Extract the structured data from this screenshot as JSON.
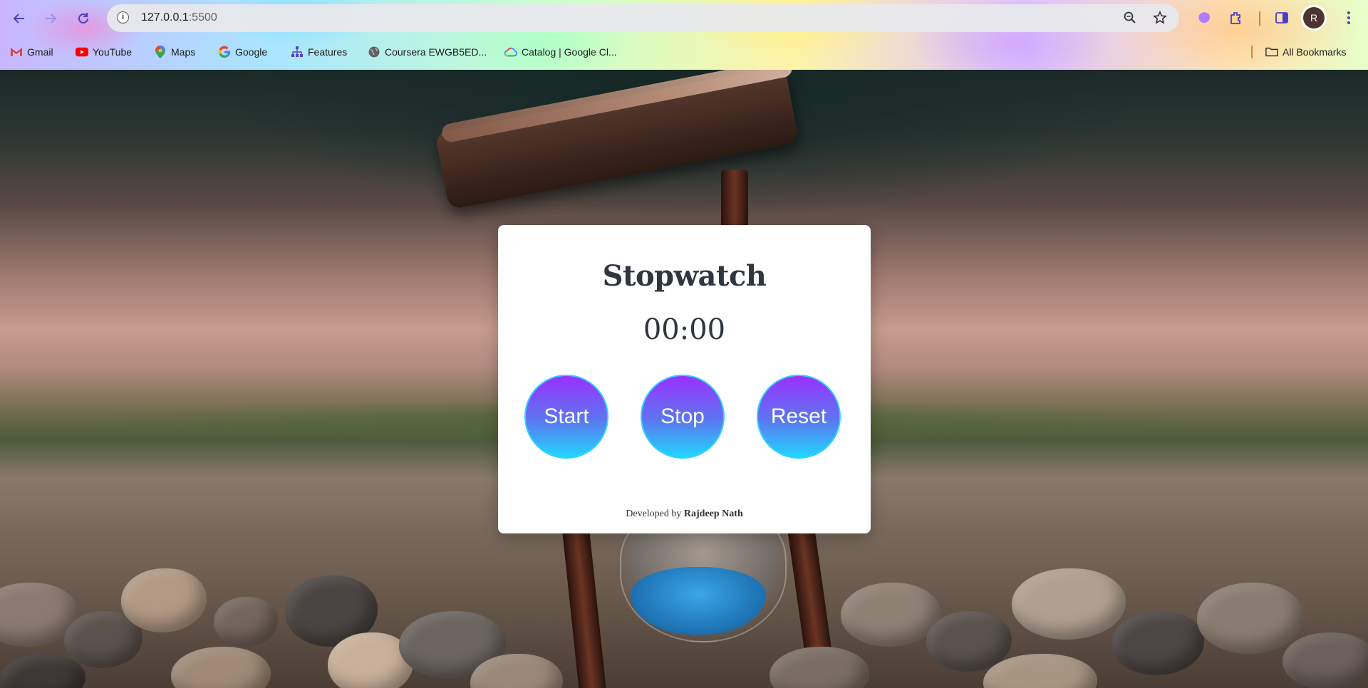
{
  "browser": {
    "url_host": "127.0.0.1",
    "url_port": ":5500",
    "avatar_letter": "R",
    "bookmarks": [
      {
        "label": "Gmail",
        "icon": "gmail-icon"
      },
      {
        "label": "YouTube",
        "icon": "youtube-icon"
      },
      {
        "label": "Maps",
        "icon": "maps-icon"
      },
      {
        "label": "Google",
        "icon": "google-icon"
      },
      {
        "label": "Features",
        "icon": "sitemap-icon"
      },
      {
        "label": "Coursera EWGB5ED...",
        "icon": "globe-icon"
      },
      {
        "label": "Catalog | Google Cl...",
        "icon": "google-cloud-icon"
      }
    ],
    "all_bookmarks_label": "All Bookmarks"
  },
  "stopwatch": {
    "title": "Stopwatch",
    "time_display": "00:00",
    "buttons": {
      "start": "Start",
      "stop": "Stop",
      "reset": "Reset"
    },
    "footer_prefix": "Developed by",
    "footer_author": "Rajdeep Nath"
  },
  "colors": {
    "accent_gradient_top": "#9b30ff",
    "accent_gradient_bottom": "#22d6ff",
    "text_dark": "#2f3640",
    "card_bg": "#ffffff"
  }
}
